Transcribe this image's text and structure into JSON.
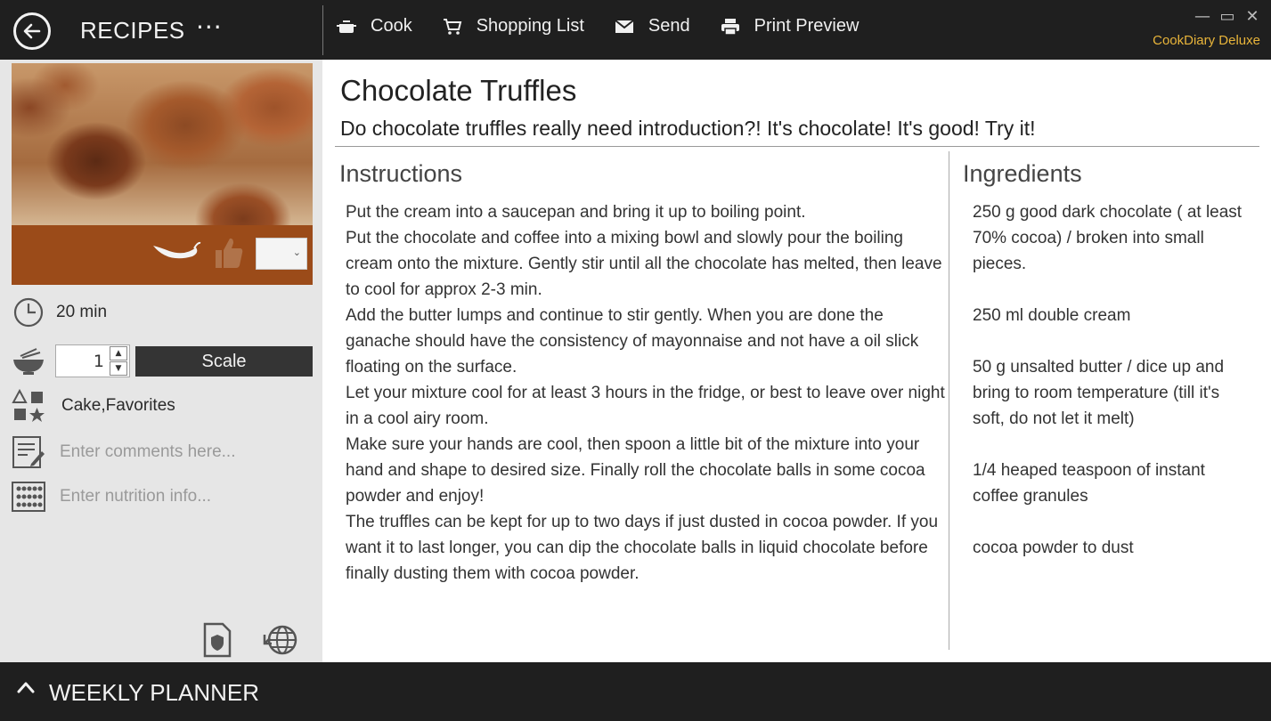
{
  "header": {
    "section_title": "RECIPES",
    "more_label": "···",
    "toolbar": [
      {
        "label": "Cook",
        "icon": "pot-icon"
      },
      {
        "label": "Shopping List",
        "icon": "cart-icon"
      },
      {
        "label": "Send",
        "icon": "mail-icon"
      },
      {
        "label": "Print Preview",
        "icon": "printer-icon"
      }
    ],
    "app_name": "CookDiary Deluxe",
    "window_controls": {
      "minimize": "—",
      "maximize": "▭",
      "close": "✕"
    }
  },
  "sidebar": {
    "time": "20 min",
    "servings": "1",
    "scale_label": "Scale",
    "categories": "Cake,Favorites",
    "comments_placeholder": "Enter comments here...",
    "nutrition_placeholder": "Enter nutrition info..."
  },
  "recipe": {
    "title": "Chocolate Truffles",
    "subtitle": "Do chocolate truffles really need introduction?! It's chocolate! It's good! Try it!",
    "instructions_heading": "Instructions",
    "instructions": [
      "Put the cream into a saucepan and bring it up to boiling point.",
      "Put the chocolate and coffee into a mixing bowl and slowly pour the boiling cream onto the mixture. Gently stir until all the chocolate has melted, then leave to cool for approx 2-3 min.",
      "Add the butter lumps and continue to stir gently. When you are done the ganache should have the consistency of mayonnaise and not have a oil slick floating on the surface.",
      "Let your mixture cool for at least 3 hours in the fridge, or best to leave over night in a cool airy room.",
      "Make sure your hands are cool, then spoon a little bit of the mixture into your hand and shape to desired size. Finally roll the chocolate balls in some cocoa powder and enjoy!",
      "The truffles can be kept for up to two days if just dusted in cocoa powder. If you want it to last longer, you can dip the chocolate balls in liquid chocolate before finally dusting them with cocoa powder."
    ],
    "ingredients_heading": "Ingredients",
    "ingredients": [
      "250 g good dark chocolate ( at least 70% cocoa) / broken into small pieces.",
      "250 ml double cream",
      "50 g unsalted butter / dice up and bring to room temperature (till it's soft, do not let it melt)",
      "1/4 heaped teaspoon of instant coffee granules",
      "cocoa powder to dust"
    ]
  },
  "footer": {
    "planner_label": "WEEKLY PLANNER"
  },
  "colors": {
    "bar_bg": "#1f1f1f",
    "accent_gold": "#e8b43a",
    "photo_strip": "#9b4b19",
    "scale_button": "#343434"
  }
}
